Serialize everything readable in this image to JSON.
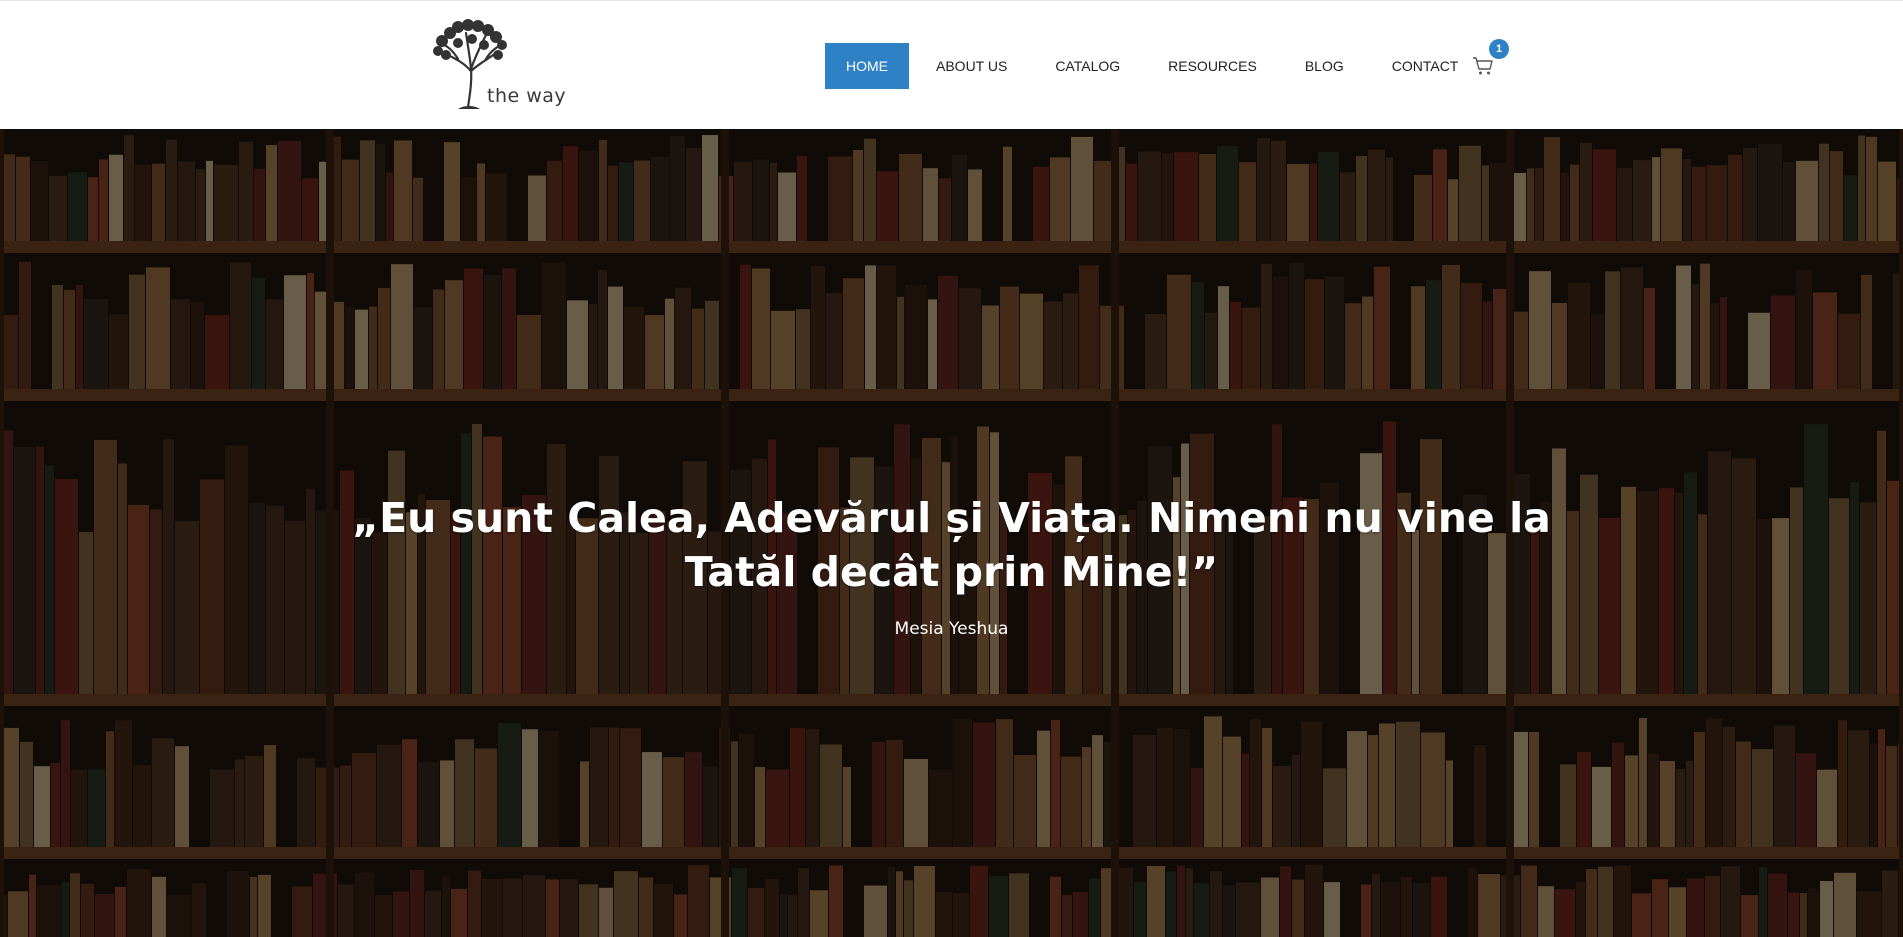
{
  "brand": {
    "name": "the way",
    "logo_icon": "tree-logo-icon"
  },
  "nav": {
    "items": [
      {
        "label": "HOME",
        "active": true
      },
      {
        "label": "ABOUT US",
        "active": false
      },
      {
        "label": "CATALOG",
        "active": false
      },
      {
        "label": "RESOURCES",
        "active": false
      },
      {
        "label": "BLOG",
        "active": false
      },
      {
        "label": "CONTACT",
        "active": false
      }
    ],
    "cart": {
      "icon": "cart-icon",
      "count": "1"
    }
  },
  "hero": {
    "quote": "„Eu sunt Calea, Adevărul și Viața. Nimeni nu vine la Tatăl decât prin Mine!”",
    "author": "Mesia Yeshua",
    "background": "bookshelf-photo"
  },
  "colors": {
    "accent": "#2f81c6",
    "nav_text": "#222222",
    "hero_text": "#ffffff"
  }
}
